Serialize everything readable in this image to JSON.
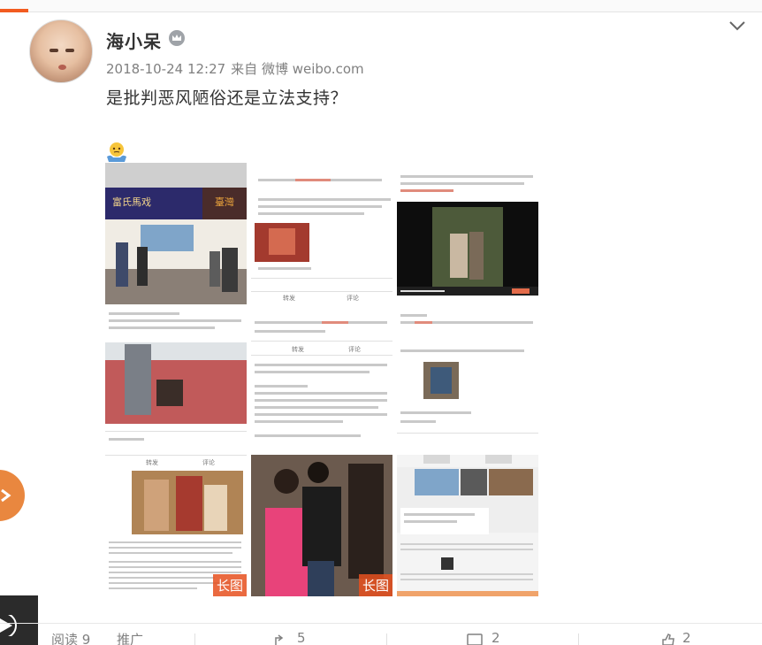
{
  "post": {
    "username": "海小呆",
    "timestamp": "2018-10-24 12:27",
    "source": "来自 微博 weibo.com",
    "text": "是批判恶风陋俗还是立法支持？",
    "badge_long_image": "长图"
  },
  "actions": {
    "read": "阅读 9",
    "promote": "推广",
    "share": "5",
    "comment": "2",
    "like": "2"
  },
  "icons": {
    "verified": "crown-icon",
    "menu": "chevron-down-icon",
    "emoji": "shrug-emoji-icon",
    "share": "share-icon",
    "comment": "comment-icon",
    "like": "like-icon"
  },
  "thumbnails": {
    "c1_sign_left": "富氏馬戏",
    "c1_sign_right": "臺灣",
    "c2_button_left": "转发",
    "c2_button_right": "评论",
    "c5_button_left": "转发",
    "c5_button_right": "评论",
    "c7_tab_a": "转发",
    "c7_tab_b": "评论"
  }
}
